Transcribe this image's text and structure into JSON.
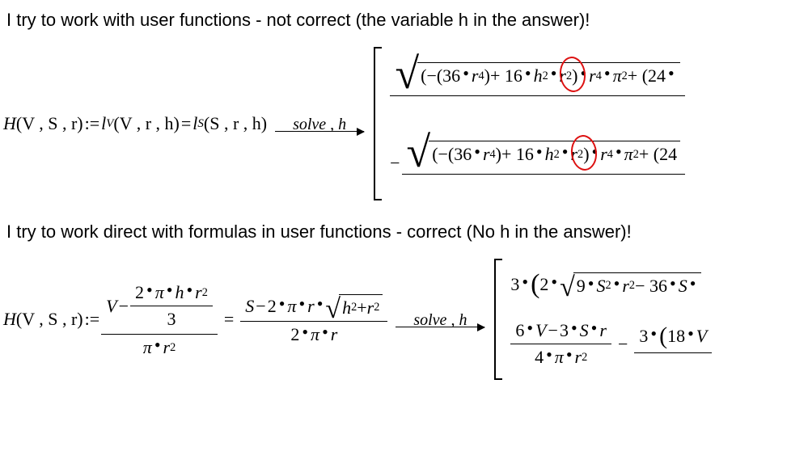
{
  "caption1": "I try to work with user functions - not correct (the variable h in the answer)!",
  "caption2": "I try to work direct with formulas in user functions - correct (No h in the answer)!",
  "eq1": {
    "lhs_prefix": "H",
    "lhs_args": "(V , S , r)",
    "assign": ":=",
    "lv": "l",
    "lv_sub": "V",
    "lv_args": "(V , r , h)",
    "eq_sym": "=",
    "ls": "l",
    "ls_sub": "S",
    "ls_args": "(S , r , h)",
    "solve_label": "solve , h",
    "expr_head": "(−(36",
    "expr_r4": "r",
    "expr_r4_pow": "4",
    "expr_close1": ")",
    "expr_plus16": " + 16",
    "expr_h2": "h",
    "expr_h2_pow": "2",
    "expr_r2": "r",
    "expr_r2_pow": "2",
    "expr_close2": ")",
    "expr_r4b": "r",
    "expr_r4b_pow": "4",
    "expr_pi": "π",
    "expr_pi_pow": "2",
    "expr_tail": " + (24"
  },
  "eq2": {
    "lhs_prefix": "H",
    "lhs_args": "(V , S , r)",
    "assign": ":=",
    "num_left_V": "V",
    "num_left_minus": "−",
    "num_inner_num": "2",
    "num_inner_pi": "π",
    "num_inner_h": "h",
    "num_inner_r": "r",
    "num_inner_r_pow": "2",
    "num_inner_den": "3",
    "den_left_pi": "π",
    "den_left_r": "r",
    "den_left_r_pow": "2",
    "eq_sym": "=",
    "rhs_num_S": "S",
    "rhs_num_minus": "−",
    "rhs_num_2": "2",
    "rhs_num_pi": "π",
    "rhs_num_r": "r",
    "rhs_rad_h": "h",
    "rhs_rad_h_pow": "2",
    "rhs_rad_plus": " + ",
    "rhs_rad_r": "r",
    "rhs_rad_r_pow": "2",
    "rhs_den_2": "2",
    "rhs_den_pi": "π",
    "rhs_den_r": "r",
    "solve_label": "solve , h",
    "sol1_3": "3",
    "sol1_2": "2",
    "sol1_9": "9",
    "sol1_S": "S",
    "sol1_S_pow": "2",
    "sol1_r": "r",
    "sol1_r_pow": "2",
    "sol1_minus": " − 36",
    "sol1_S2": "S",
    "sol2_num1_a": "6",
    "sol2_num1_V": "V",
    "sol2_num1_m": "−",
    "sol2_num1_3": "3",
    "sol2_num1_S": "S",
    "sol2_num1_r": "r",
    "sol2_den1_4": "4",
    "sol2_den1_pi": "π",
    "sol2_den1_r": "r",
    "sol2_den1_r_pow": "2",
    "sol2_minus": "−",
    "sol2_num2_3": "3",
    "sol2_num2_18": "18",
    "sol2_num2_V": "V"
  }
}
